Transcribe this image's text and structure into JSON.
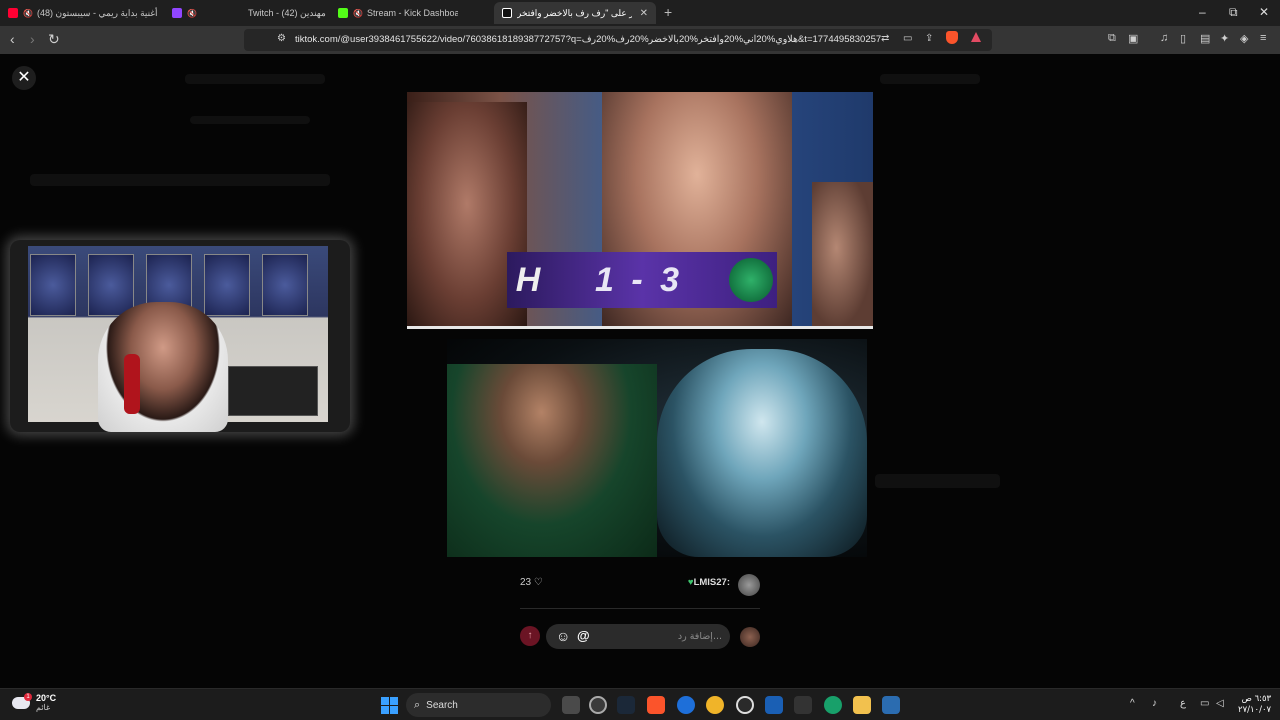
{
  "browser": {
    "tabs": [
      {
        "title": "(48) أغنية بداية ريمي - سيبستون",
        "favicon_color": "#ff0033",
        "muted": true
      },
      {
        "title": "",
        "favicon_color": "#9146ff",
        "muted": true
      },
      {
        "title": "Twitch - (42) مهندين",
        "favicon_color": "#9146ff",
        "muted": false
      },
      {
        "title": "Stream - Kick Dashboard",
        "favicon_color": "#53fc18",
        "muted": true
      },
      {
        "title": "اعثر على \"رف رف بالاخضر وافتخر...",
        "favicon_color": "#ffffff",
        "muted": false,
        "active": true
      }
    ],
    "new_tab_label": "+",
    "window_controls": {
      "minimize": "–",
      "restore": "⧉",
      "close": "✕"
    },
    "url": "tiktok.com/@user3938461755622/video/7603861818938772757?q=هلاوي%20اني%20وافتخر%20بالاخضر%20رف%20رف&t=1774495830257",
    "nav": {
      "back": "‹",
      "forward": "›",
      "reload": "↻"
    }
  },
  "page": {
    "close_label": "✕",
    "post_image": {
      "score_text": "1 - 3",
      "hilal_mark": "H"
    },
    "comment": {
      "likes": "23",
      "username": "LMIS27:"
    },
    "reply": {
      "placeholder": "إضافة رد...",
      "send_icon": "↑",
      "emoji_icon": "☺",
      "mention_icon": "@"
    }
  },
  "taskbar": {
    "weather_temp": "20°C",
    "weather_cond": "غائم",
    "weather_badge": "1",
    "search_label": "Search",
    "lang": "ع",
    "time": "٦:٥٣ ص",
    "date": "٢٧/١٠/٠٧"
  },
  "colors": {
    "accent_active_tab": "#353535",
    "brave_orange": "#fb542b",
    "send_button": "#6b1424"
  }
}
